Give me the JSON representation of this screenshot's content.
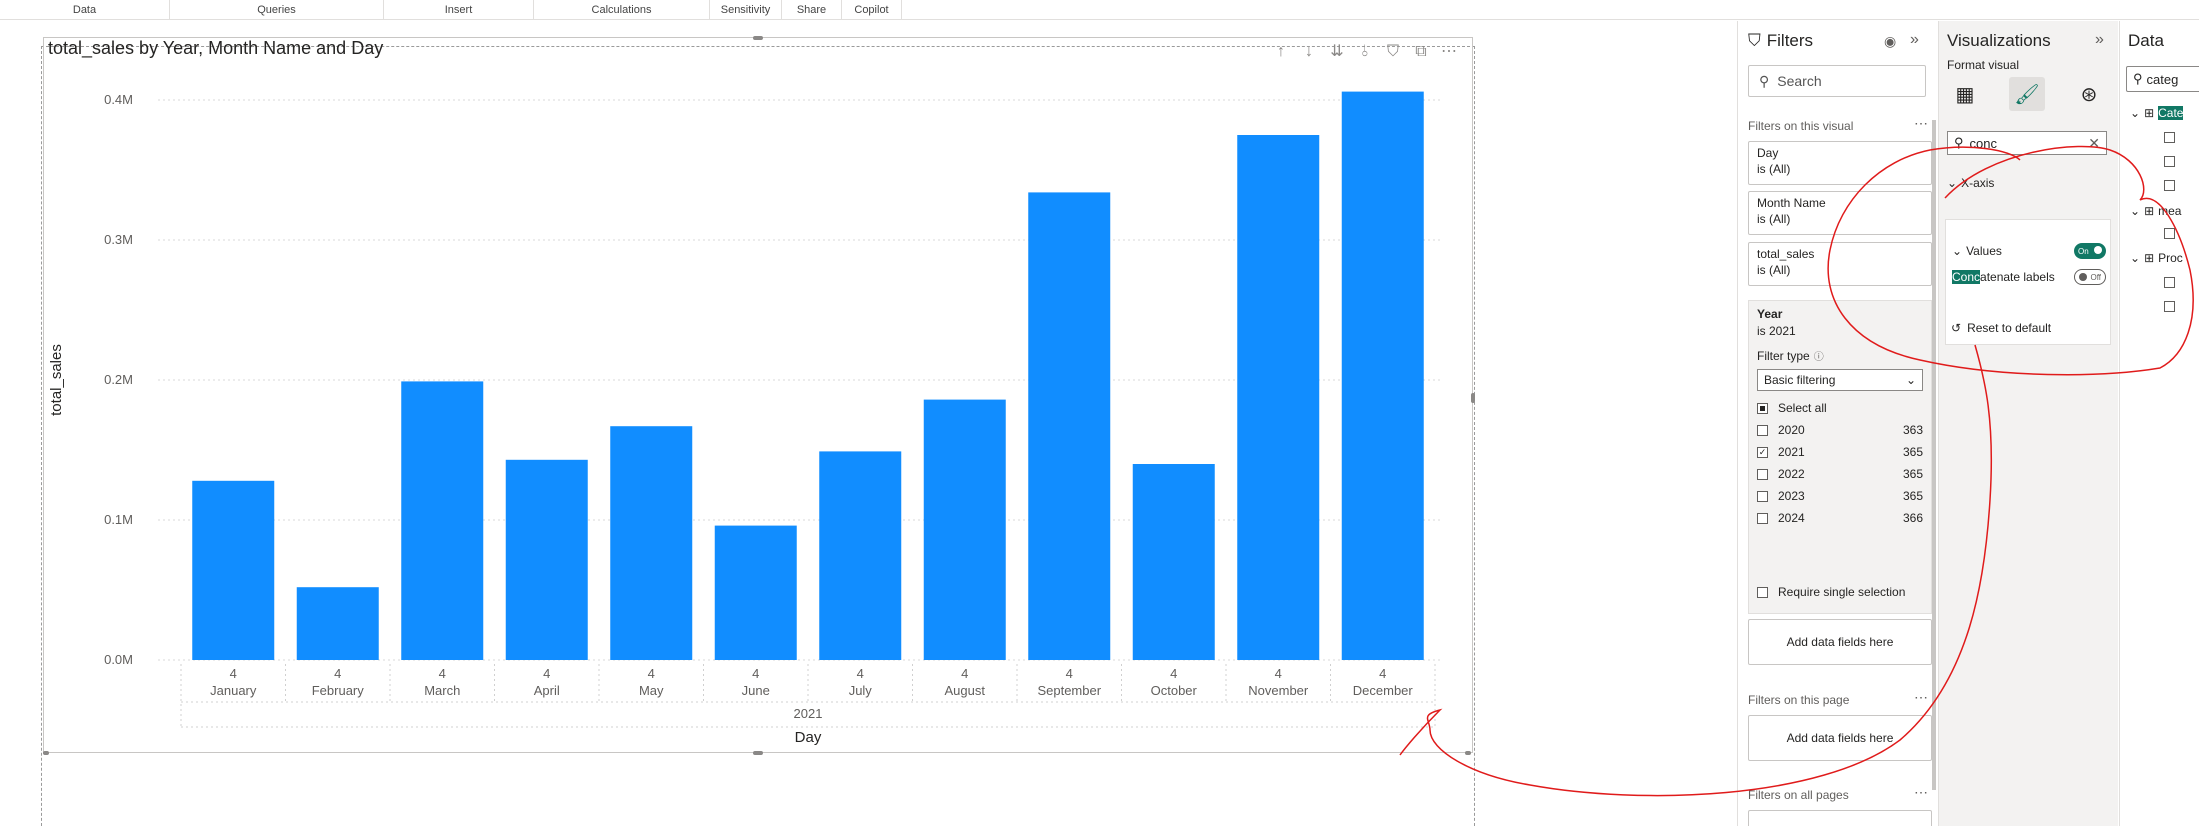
{
  "ribbon": {
    "groups": [
      "Data",
      "Queries",
      "Insert",
      "Calculations",
      "Sensitivity",
      "Share",
      "Copilot"
    ]
  },
  "visual": {
    "title": "total_sales by Year, Month Name and Day",
    "toolbar_icons": [
      "drill-up-icon",
      "drill-down-icon",
      "expand-all-down-icon",
      "expand-next-level-icon",
      "filter-icon",
      "focus-mode-icon",
      "more-options-icon"
    ]
  },
  "chart_data": {
    "type": "bar",
    "title": "total_sales by Year, Month Name and Day",
    "categories": [
      "January",
      "February",
      "March",
      "April",
      "May",
      "June",
      "July",
      "August",
      "September",
      "October",
      "November",
      "December"
    ],
    "day_labels": [
      "4",
      "4",
      "4",
      "4",
      "4",
      "4",
      "4",
      "4",
      "4",
      "4",
      "4",
      "4"
    ],
    "year_label": "2021",
    "values": [
      128000,
      52000,
      199000,
      143000,
      167000,
      96000,
      149000,
      186000,
      334000,
      140000,
      375000,
      406000
    ],
    "xlabel": "Day",
    "ylabel": "total_sales",
    "y_ticks": [
      "0.0M",
      "0.1M",
      "0.2M",
      "0.3M",
      "0.4M"
    ],
    "ylim": [
      0,
      400000
    ],
    "grid": true,
    "bar_color": "#118DFF"
  },
  "filters": {
    "title": "Filters",
    "search_placeholder": "Search",
    "on_visual_label": "Filters on this visual",
    "cards": [
      {
        "field": "Day",
        "state": "is (All)"
      },
      {
        "field": "Month Name",
        "state": "is (All)"
      },
      {
        "field": "total_sales",
        "state": "is (All)"
      }
    ],
    "year_card": {
      "field": "Year",
      "state": "is 2021",
      "filter_type_label": "Filter type",
      "filter_type_value": "Basic filtering",
      "select_all": "Select all",
      "options": [
        {
          "label": "2020",
          "count": "363",
          "checked": false
        },
        {
          "label": "2021",
          "count": "365",
          "checked": true
        },
        {
          "label": "2022",
          "count": "365",
          "checked": false
        },
        {
          "label": "2023",
          "count": "365",
          "checked": false
        },
        {
          "label": "2024",
          "count": "366",
          "checked": false
        }
      ],
      "require_single": "Require single selection"
    },
    "add_fields": "Add data fields here",
    "on_page_label": "Filters on this page",
    "on_all_pages_label": "Filters on all pages"
  },
  "visualizations": {
    "title": "Visualizations",
    "format_visual": "Format visual",
    "search_value": "conc",
    "x_axis_label": "X-axis",
    "values_label": "Values",
    "values_toggle": "On",
    "concat_highlight": "Conc",
    "concat_rest": "atenate labels",
    "concat_toggle": "Off",
    "reset_label": "Reset to default",
    "annotation_color": "#E01B1B"
  },
  "data_pane": {
    "title": "Data",
    "search_value": "categ",
    "items": [
      "Cate",
      "mea",
      "Proc"
    ]
  }
}
